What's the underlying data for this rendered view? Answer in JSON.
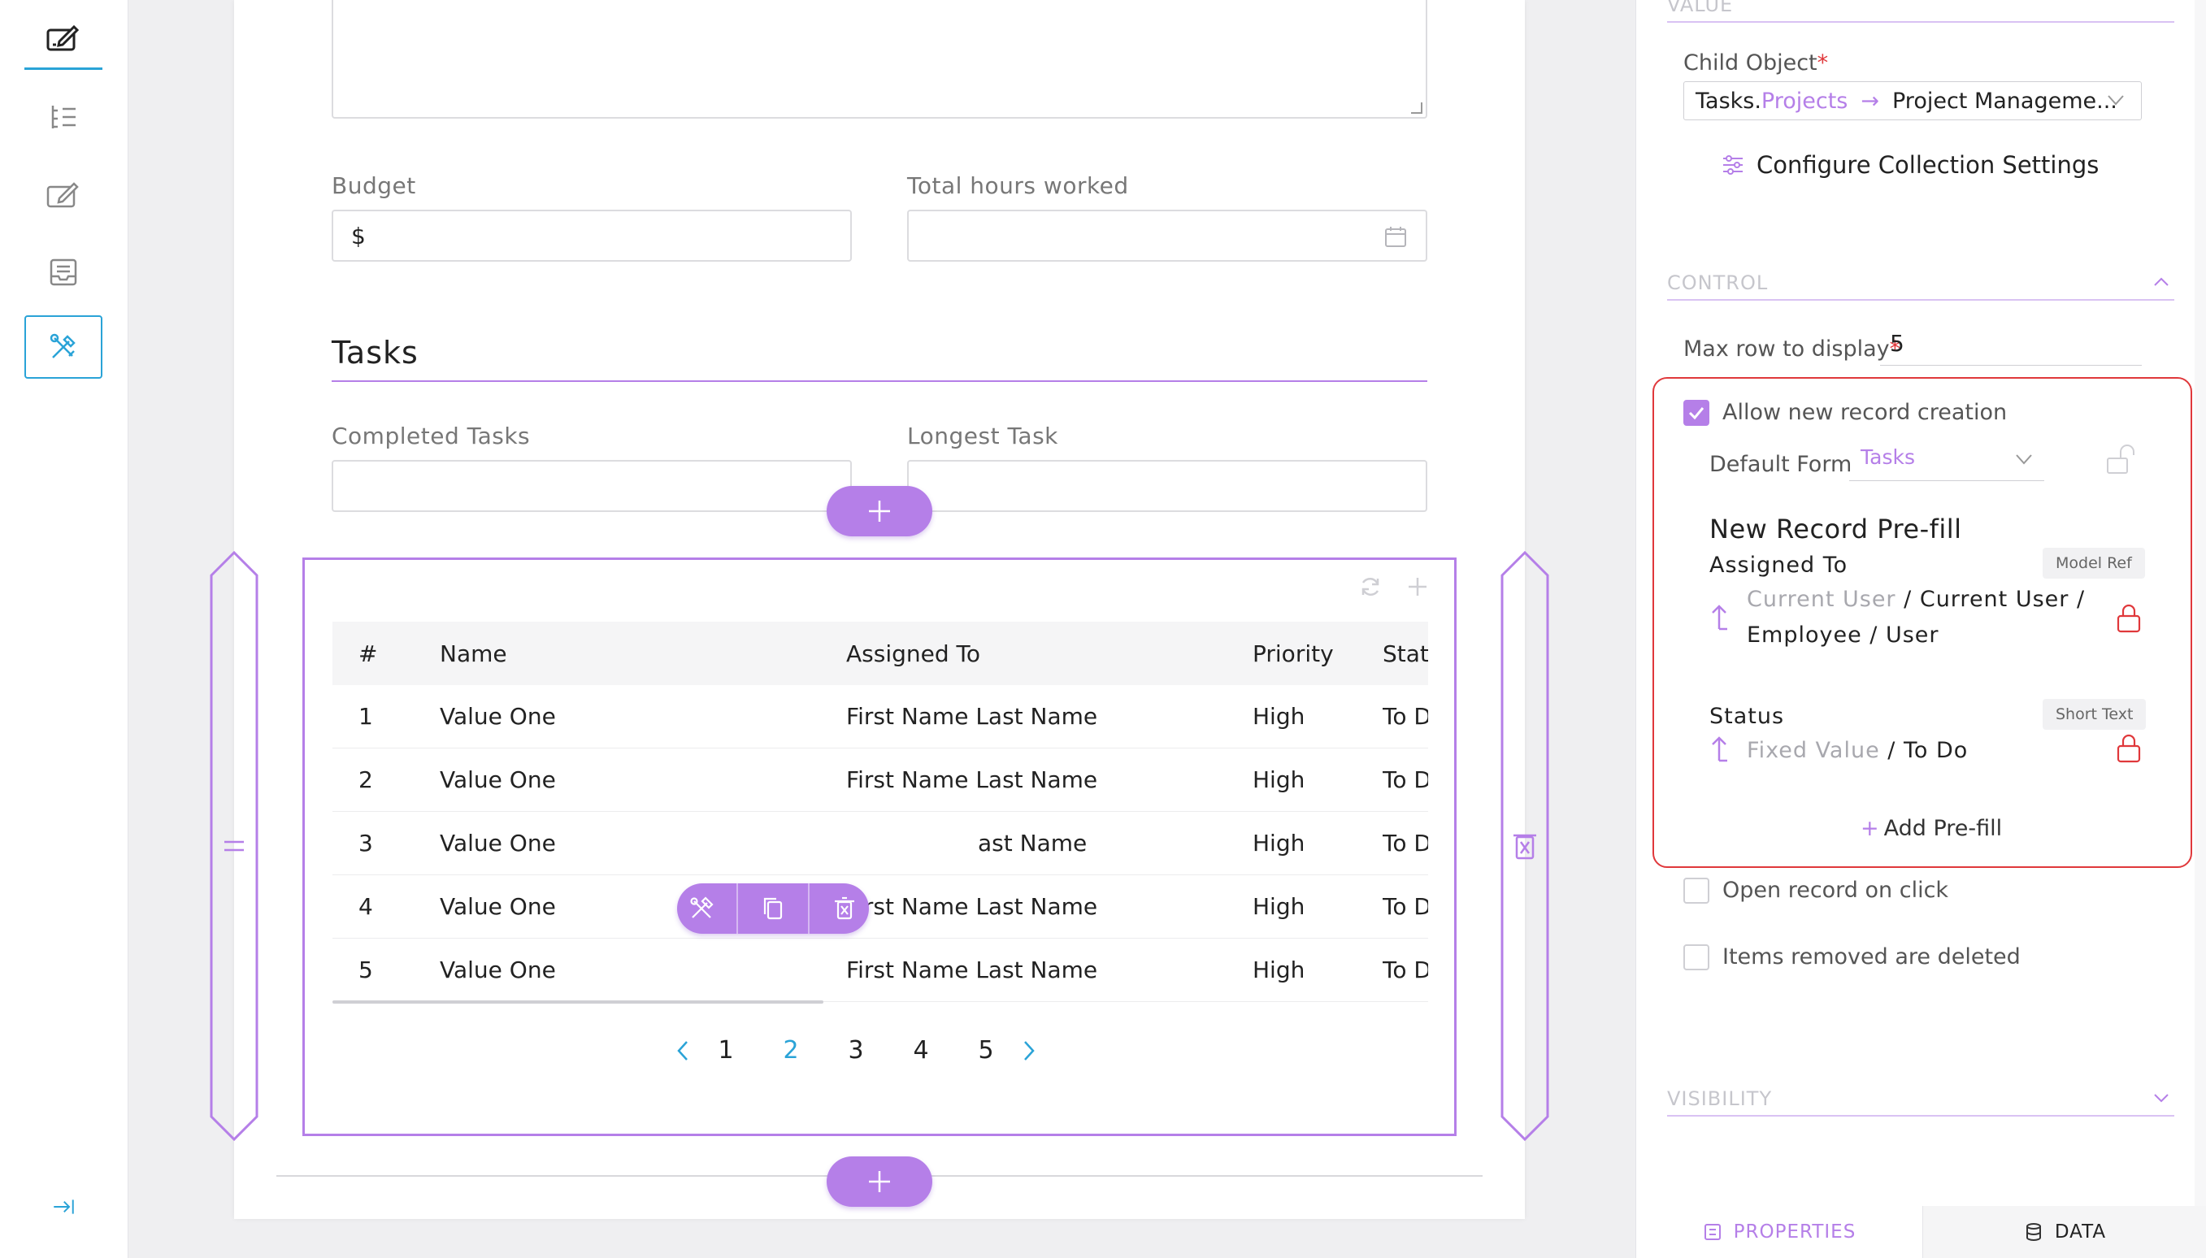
{
  "rail": {
    "items": [
      {
        "icon": "form-edit-icon",
        "active": true
      },
      {
        "icon": "list-icon"
      },
      {
        "icon": "edit-icon"
      },
      {
        "icon": "inbox-icon"
      },
      {
        "icon": "tools-icon",
        "selected": true
      }
    ],
    "collapse_icon": "collapse-arrow-icon"
  },
  "form": {
    "budget_label": "Budget",
    "budget_value": "$",
    "hours_label": "Total hours worked",
    "hours_value": "",
    "section_title": "Tasks",
    "completed_label": "Completed Tasks",
    "completed_value": "",
    "longest_label": "Longest Task",
    "longest_value": ""
  },
  "table": {
    "columns": [
      "#",
      "Name",
      "Assigned To",
      "Priority",
      "Stat"
    ],
    "rows": [
      {
        "num": "1",
        "name": "Value One",
        "assigned": "First Name Last Name",
        "priority": "High",
        "status": "To D"
      },
      {
        "num": "2",
        "name": "Value One",
        "assigned": "First Name Last Name",
        "priority": "High",
        "status": "To D"
      },
      {
        "num": "3",
        "name": "Value One",
        "assigned": "ast Name",
        "priority": "High",
        "status": "To D"
      },
      {
        "num": "4",
        "name": "Value One",
        "assigned": "First Name Last Name",
        "priority": "High",
        "status": "To D"
      },
      {
        "num": "5",
        "name": "Value One",
        "assigned": "First Name Last Name",
        "priority": "High",
        "status": "To D"
      }
    ],
    "pages": [
      "1",
      "2",
      "3",
      "4",
      "5"
    ],
    "current_page": "2"
  },
  "panel": {
    "value_section": "VALUE",
    "child_object_label": "Child Object",
    "child_object": {
      "base": "Tasks.",
      "relation": "Projects",
      "arrow": "→",
      "target": "Project Manageme..."
    },
    "configure_link": "Configure Collection Settings",
    "control_section": "CONTROL",
    "max_rows_label": "Max row to display",
    "max_rows_value": "5",
    "allow_new_label": "Allow new record creation",
    "allow_new_checked": true,
    "default_form_label": "Default Form",
    "default_form_value": "Tasks",
    "prefill_title": "New Record Pre-fill",
    "prefills": [
      {
        "name": "Assigned To",
        "tag": "Model Ref",
        "source": "Current User",
        "sep": "/",
        "line1": "Current User /",
        "line2": "Employee / User"
      },
      {
        "name": "Status",
        "tag": "Short Text",
        "source": "Fixed Value",
        "sep": "/",
        "line1": "To Do"
      }
    ],
    "add_prefill": "Add Pre-fill",
    "open_on_click_label": "Open record on click",
    "removed_deleted_label": "Items removed are deleted",
    "visibility_section": "VISIBILITY",
    "tabs": {
      "properties": "PROPERTIES",
      "data": "DATA"
    }
  },
  "colors": {
    "accent": "#b57fe8",
    "active_blue": "#2aa3d7",
    "danger": "#e0383b"
  }
}
